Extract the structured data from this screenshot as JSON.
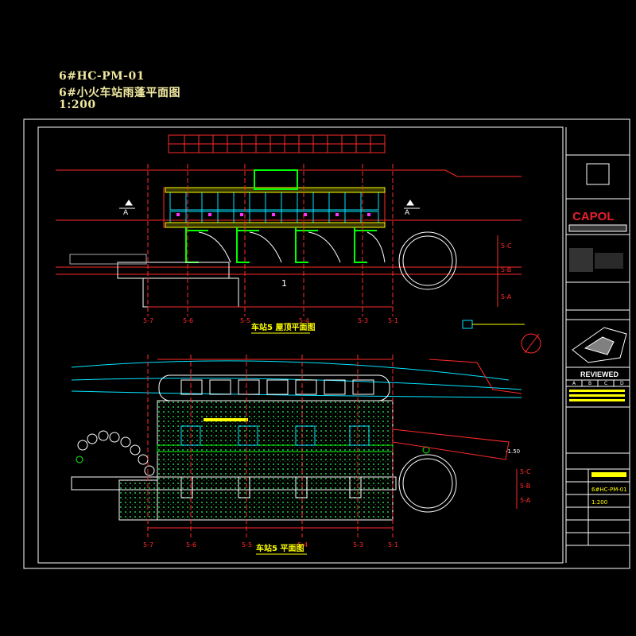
{
  "header": {
    "code": "6#HC-PM-01",
    "title": "6#小火车站雨蓬平面图",
    "scale": "1:200"
  },
  "drawing": {
    "top_plan_title": "车站5 屋顶平面图",
    "bottom_plan_title": "车站5 平面图",
    "section_marker": "1",
    "section_marker_letter": "A",
    "axis_labels_bottom": [
      "5-7",
      "5-6",
      "5-5",
      "5-4",
      "5-3",
      "5-1"
    ],
    "axis_labels_right": [
      "5-C",
      "5-B",
      "5-A"
    ],
    "elevation": "-1.50"
  },
  "title_block": {
    "logo": "CAPOL",
    "reviewed": "REVIEWED",
    "review_cols": [
      "A",
      "B",
      "C",
      "D"
    ],
    "scale": "1:200",
    "drawing_no": "6#HC-PM-01"
  },
  "colors": {
    "background": "#000000",
    "frame": "#ffffff",
    "green": "#00ff00",
    "red": "#ff2a2a",
    "cyan": "#00e5ff",
    "yellow": "#ffff00",
    "magenta": "#ff33ff",
    "header_text": "#f0e8a0",
    "capol_red": "#e8202a"
  }
}
